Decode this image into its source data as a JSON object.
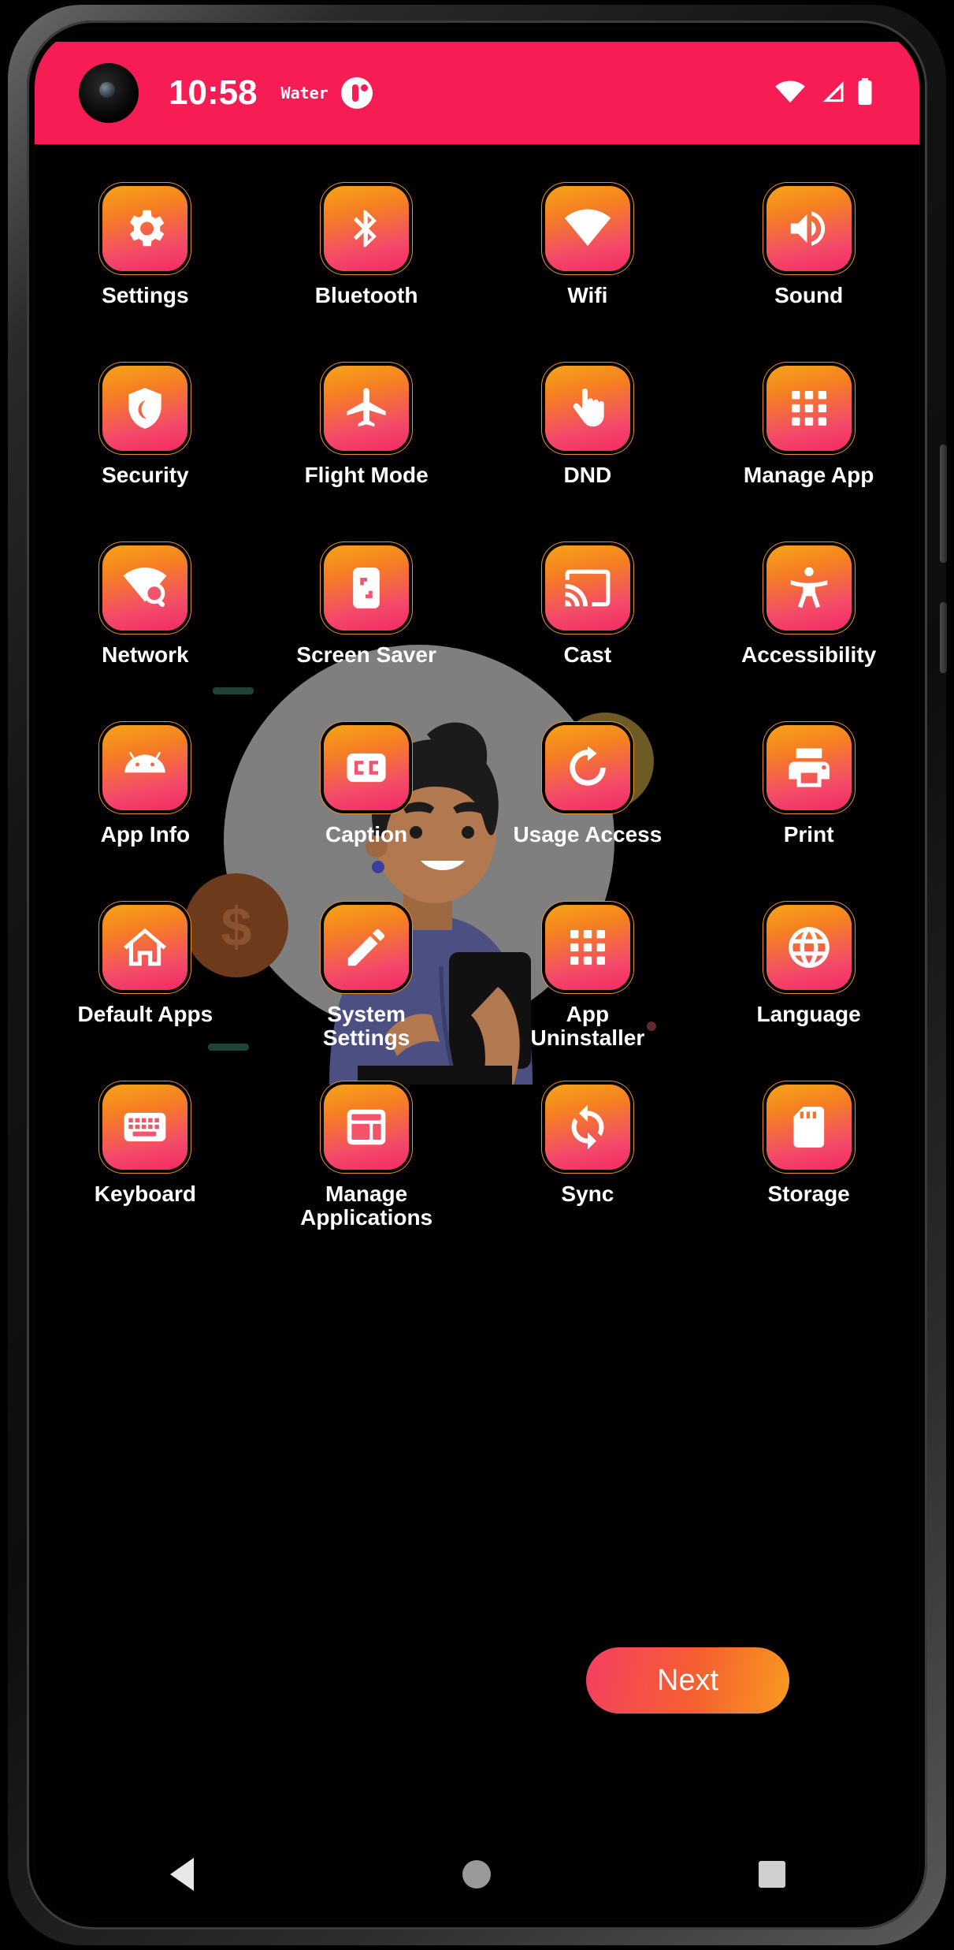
{
  "status_bar": {
    "time": "10:58",
    "app_name": "Water",
    "app_icon": "water-reminder-icon",
    "wifi_icon": "wifi-icon",
    "signal_icon": "cellular-signal-icon",
    "battery_icon": "battery-full-icon",
    "background_color": "#f71c53"
  },
  "theme": {
    "tile_gradient_start": "#f7a319",
    "tile_gradient_end": "#f42a63",
    "screen_background": "#000000",
    "label_color": "#ffffff"
  },
  "apps": [
    {
      "label": "Settings",
      "icon": "gear-icon"
    },
    {
      "label": "Bluetooth",
      "icon": "bluetooth-icon"
    },
    {
      "label": "Wifi",
      "icon": "wifi-icon"
    },
    {
      "label": "Sound",
      "icon": "speaker-volume-icon"
    },
    {
      "label": "Security",
      "icon": "shield-moon-icon"
    },
    {
      "label": "Flight Mode",
      "icon": "airplane-icon"
    },
    {
      "label": "DND",
      "icon": "raised-hand-icon"
    },
    {
      "label": "Manage App",
      "icon": "app-grid-icon"
    },
    {
      "label": "Network",
      "icon": "wifi-search-icon"
    },
    {
      "label": "Screen Saver",
      "icon": "phone-fullscreen-icon"
    },
    {
      "label": "Cast",
      "icon": "cast-screen-icon"
    },
    {
      "label": "Accessibility",
      "icon": "accessibility-person-icon"
    },
    {
      "label": "App Info",
      "icon": "android-robot-icon"
    },
    {
      "label": "Caption",
      "icon": "closed-caption-icon"
    },
    {
      "label": "Usage Access",
      "icon": "refresh-circle-icon"
    },
    {
      "label": "Print",
      "icon": "printer-icon"
    },
    {
      "label": "Default Apps",
      "icon": "home-outline-icon"
    },
    {
      "label": "System\nSettings",
      "icon": "pencil-edit-icon"
    },
    {
      "label": "App\nUninstaller",
      "icon": "app-grid-icon"
    },
    {
      "label": "Language",
      "icon": "globe-icon"
    },
    {
      "label": "Keyboard",
      "icon": "keyboard-icon"
    },
    {
      "label": "Manage\nApplications",
      "icon": "layout-panels-icon"
    },
    {
      "label": "Sync",
      "icon": "sync-arrows-icon"
    },
    {
      "label": "Storage",
      "icon": "sd-card-icon"
    }
  ],
  "footer": {
    "next_label": "Next"
  },
  "nav_bar": {
    "back": "back-triangle-icon",
    "home": "home-circle-icon",
    "recents": "recents-square-icon"
  },
  "illustration": {
    "name": "person-holding-phone-illustration",
    "circle_color": "#8a8a8a",
    "skin_color": "#b2784f",
    "hair_color": "#1b1b1b",
    "shirt_color": "#4b4f82",
    "coin_label": "$",
    "heart_badge": "heart-icon"
  }
}
